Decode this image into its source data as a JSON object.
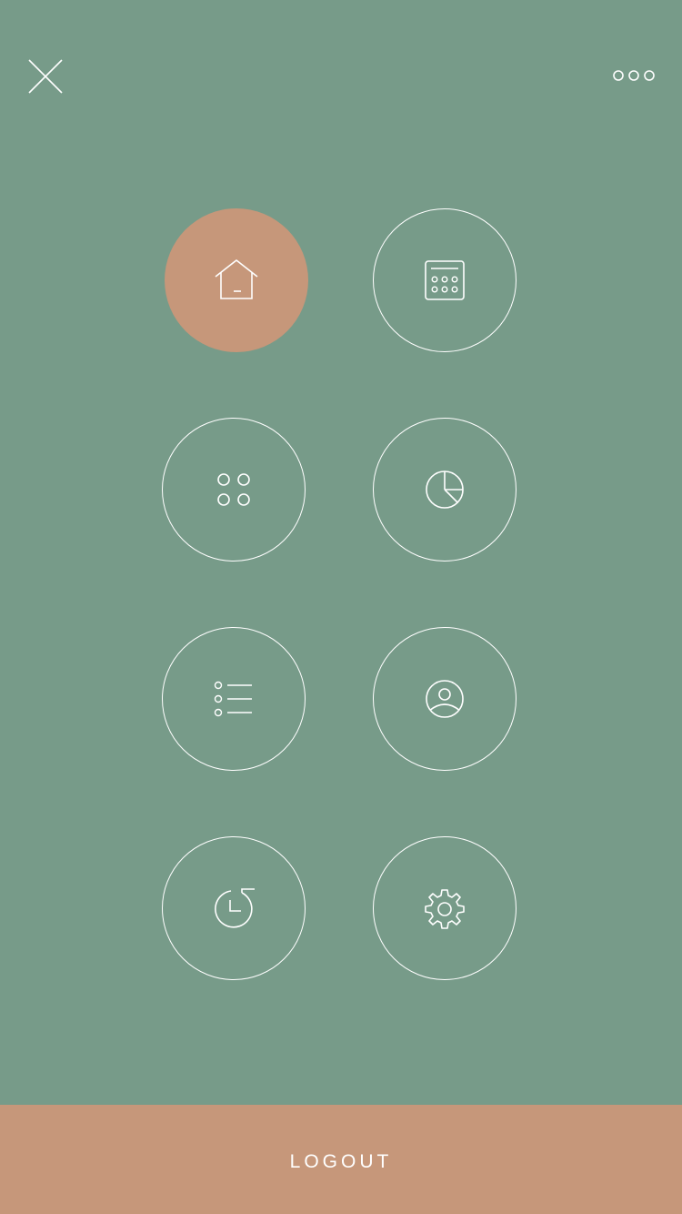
{
  "theme": {
    "background": "#779b89",
    "accent": "#c6977a",
    "stroke": "#ffffff"
  },
  "header": {
    "close_icon": "close-icon",
    "more_icon": "more-options-icon"
  },
  "menu": {
    "items": [
      {
        "id": "home",
        "icon": "home-icon",
        "active": true
      },
      {
        "id": "calendar",
        "icon": "calendar-icon",
        "active": false
      },
      {
        "id": "apps",
        "icon": "apps-grid-icon",
        "active": false
      },
      {
        "id": "stats",
        "icon": "pie-chart-icon",
        "active": false
      },
      {
        "id": "list",
        "icon": "list-icon",
        "active": false
      },
      {
        "id": "profile",
        "icon": "user-profile-icon",
        "active": false
      },
      {
        "id": "history",
        "icon": "history-icon",
        "active": false
      },
      {
        "id": "settings",
        "icon": "gear-icon",
        "active": false
      }
    ]
  },
  "footer": {
    "logout_label": "LOGOUT"
  }
}
